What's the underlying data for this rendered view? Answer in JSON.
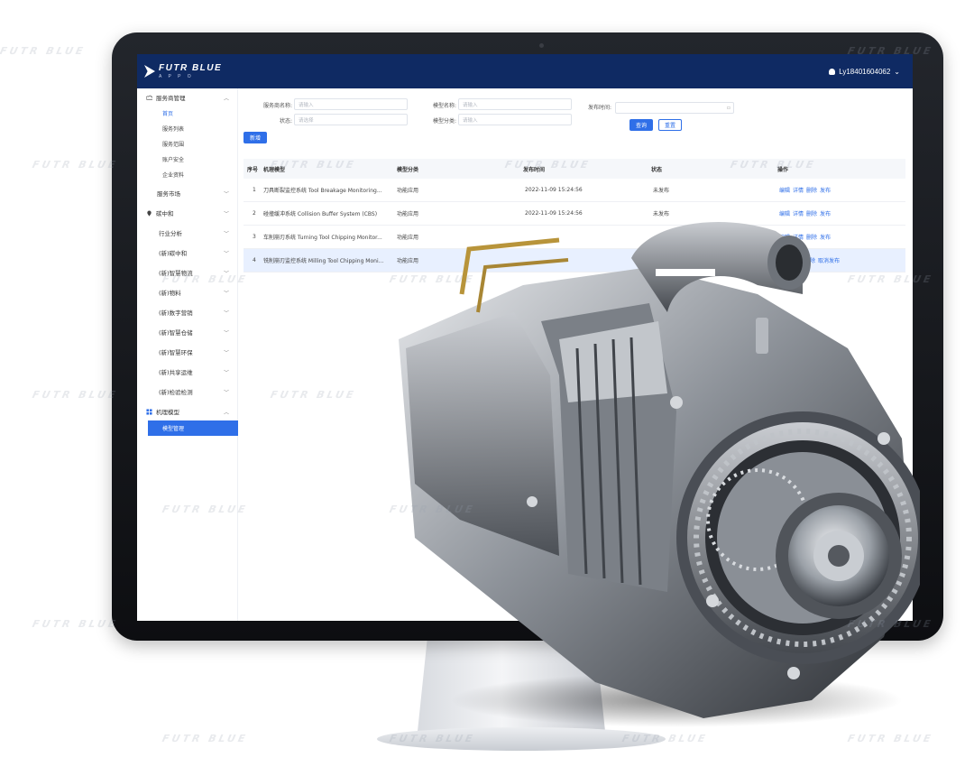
{
  "brand": {
    "name": "FUTR BLUE",
    "sub": "A P P O"
  },
  "user": {
    "label": "Ly18401604062"
  },
  "sidebar": {
    "groups": [
      {
        "label": "服务商管理",
        "expanded": true,
        "items": [
          "首页",
          "服务列表",
          "服务范围",
          "账户安全",
          "企业资料"
        ]
      },
      {
        "label": "服务市场"
      },
      {
        "label": "碳中和"
      },
      {
        "label": "行业分析"
      },
      {
        "label": "(新)碳中和"
      },
      {
        "label": "(新)智慧物流"
      },
      {
        "label": "(新)物料"
      },
      {
        "label": "(新)数字营销"
      },
      {
        "label": "(新)智慧仓储"
      },
      {
        "label": "(新)智慧环保"
      },
      {
        "label": "(新)共享运维"
      },
      {
        "label": "(新)检验检测"
      },
      {
        "label": "机理模型",
        "expanded": true,
        "items": [
          "模型管理"
        ]
      }
    ]
  },
  "filters": {
    "service_name": {
      "label": "服务商名称:",
      "placeholder": "请输入"
    },
    "model_name": {
      "label": "模型名称:",
      "placeholder": "请输入"
    },
    "publish_time": {
      "label": "发布时间:",
      "placeholder": ""
    },
    "status": {
      "label": "状态:",
      "placeholder": "请选择"
    },
    "model_category": {
      "label": "模型分类:",
      "placeholder": "请输入"
    },
    "query_button": "查询",
    "reset_button": "重置",
    "add_button": "新增"
  },
  "table": {
    "headers": [
      "序号",
      "机理模型",
      "模型分类",
      "发布时间",
      "状态",
      "操作"
    ],
    "rows": [
      {
        "index": "1",
        "model": "刀具断裂监控系统 Tool Breakage Monitoring...",
        "category": "功能应用",
        "time": "2022-11-09 15:24:56",
        "status": "未发布",
        "ops": [
          "编辑",
          "详情",
          "删除",
          "发布"
        ]
      },
      {
        "index": "2",
        "model": "碰撞缓冲系统 Collision Buffer System (CBS)",
        "category": "功能应用",
        "time": "2022-11-09 15:24:56",
        "status": "未发布",
        "ops": [
          "编辑",
          "详情",
          "删除",
          "发布"
        ]
      },
      {
        "index": "3",
        "model": "车削崩刃系统 Turning Tool Chipping Monitor...",
        "category": "功能应用",
        "time": "",
        "status": "",
        "ops": [
          "编辑",
          "详情",
          "删除",
          "发布"
        ]
      },
      {
        "index": "4",
        "model": "铣削崩刃监控系统 Milling Tool Chipping Moni...",
        "category": "功能应用",
        "time": "",
        "status": "",
        "ops": [
          "删除",
          "取消发布"
        ]
      }
    ]
  },
  "watermark": "FUTR BLUE",
  "colors": {
    "topbar": "#0f2a63",
    "accent": "#2f6fe8",
    "bezel": "#16181c",
    "highlight_row": "#e8f0ff"
  }
}
